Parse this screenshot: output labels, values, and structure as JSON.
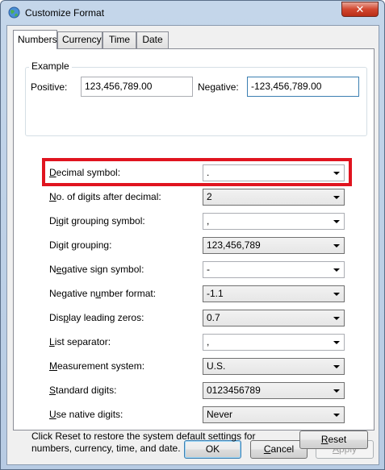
{
  "window": {
    "title": "Customize Format",
    "close_label": "✕"
  },
  "tabs": [
    {
      "label": "Numbers",
      "active": true
    },
    {
      "label": "Currency",
      "active": false
    },
    {
      "label": "Time",
      "active": false
    },
    {
      "label": "Date",
      "active": false
    }
  ],
  "example": {
    "group_label": "Example",
    "positive_label": "Positive:",
    "positive_value": "123,456,789.00",
    "negative_label": "Negative:",
    "negative_value": "-123,456,789.00"
  },
  "settings": [
    {
      "label_pre": "",
      "label_u": "D",
      "label_post": "ecimal symbol:",
      "value": ".",
      "style": "white"
    },
    {
      "label_pre": "",
      "label_u": "N",
      "label_post": "o. of digits after decimal:",
      "value": "2",
      "style": "grey"
    },
    {
      "label_pre": "D",
      "label_u": "i",
      "label_post": "git grouping symbol:",
      "value": ",",
      "style": "white"
    },
    {
      "label_pre": "Di",
      "label_u": "g",
      "label_post": "it grouping:",
      "value": "123,456,789",
      "style": "grey"
    },
    {
      "label_pre": "N",
      "label_u": "e",
      "label_post": "gative sign symbol:",
      "value": "-",
      "style": "white"
    },
    {
      "label_pre": "Negative n",
      "label_u": "u",
      "label_post": "mber format:",
      "value": "-1.1",
      "style": "grey"
    },
    {
      "label_pre": "Dis",
      "label_u": "p",
      "label_post": "lay leading zeros:",
      "value": "0.7",
      "style": "grey"
    },
    {
      "label_pre": "",
      "label_u": "L",
      "label_post": "ist separator:",
      "value": ",",
      "style": "white"
    },
    {
      "label_pre": "",
      "label_u": "M",
      "label_post": "easurement system:",
      "value": "U.S.",
      "style": "grey"
    },
    {
      "label_pre": "",
      "label_u": "S",
      "label_post": "tandard digits:",
      "value": "0123456789",
      "style": "grey"
    },
    {
      "label_pre": "",
      "label_u": "U",
      "label_post": "se native digits:",
      "value": "Never",
      "style": "grey"
    }
  ],
  "info": {
    "text": "Click Reset to restore the system default settings for numbers, currency, time, and date."
  },
  "buttons": {
    "reset": {
      "pre": "",
      "u": "R",
      "post": "eset"
    },
    "ok": "OK",
    "cancel": {
      "pre": "",
      "u": "C",
      "post": "ancel"
    },
    "apply": {
      "pre": "",
      "u": "A",
      "post": "pply"
    }
  },
  "highlight_color": "#e0141f"
}
